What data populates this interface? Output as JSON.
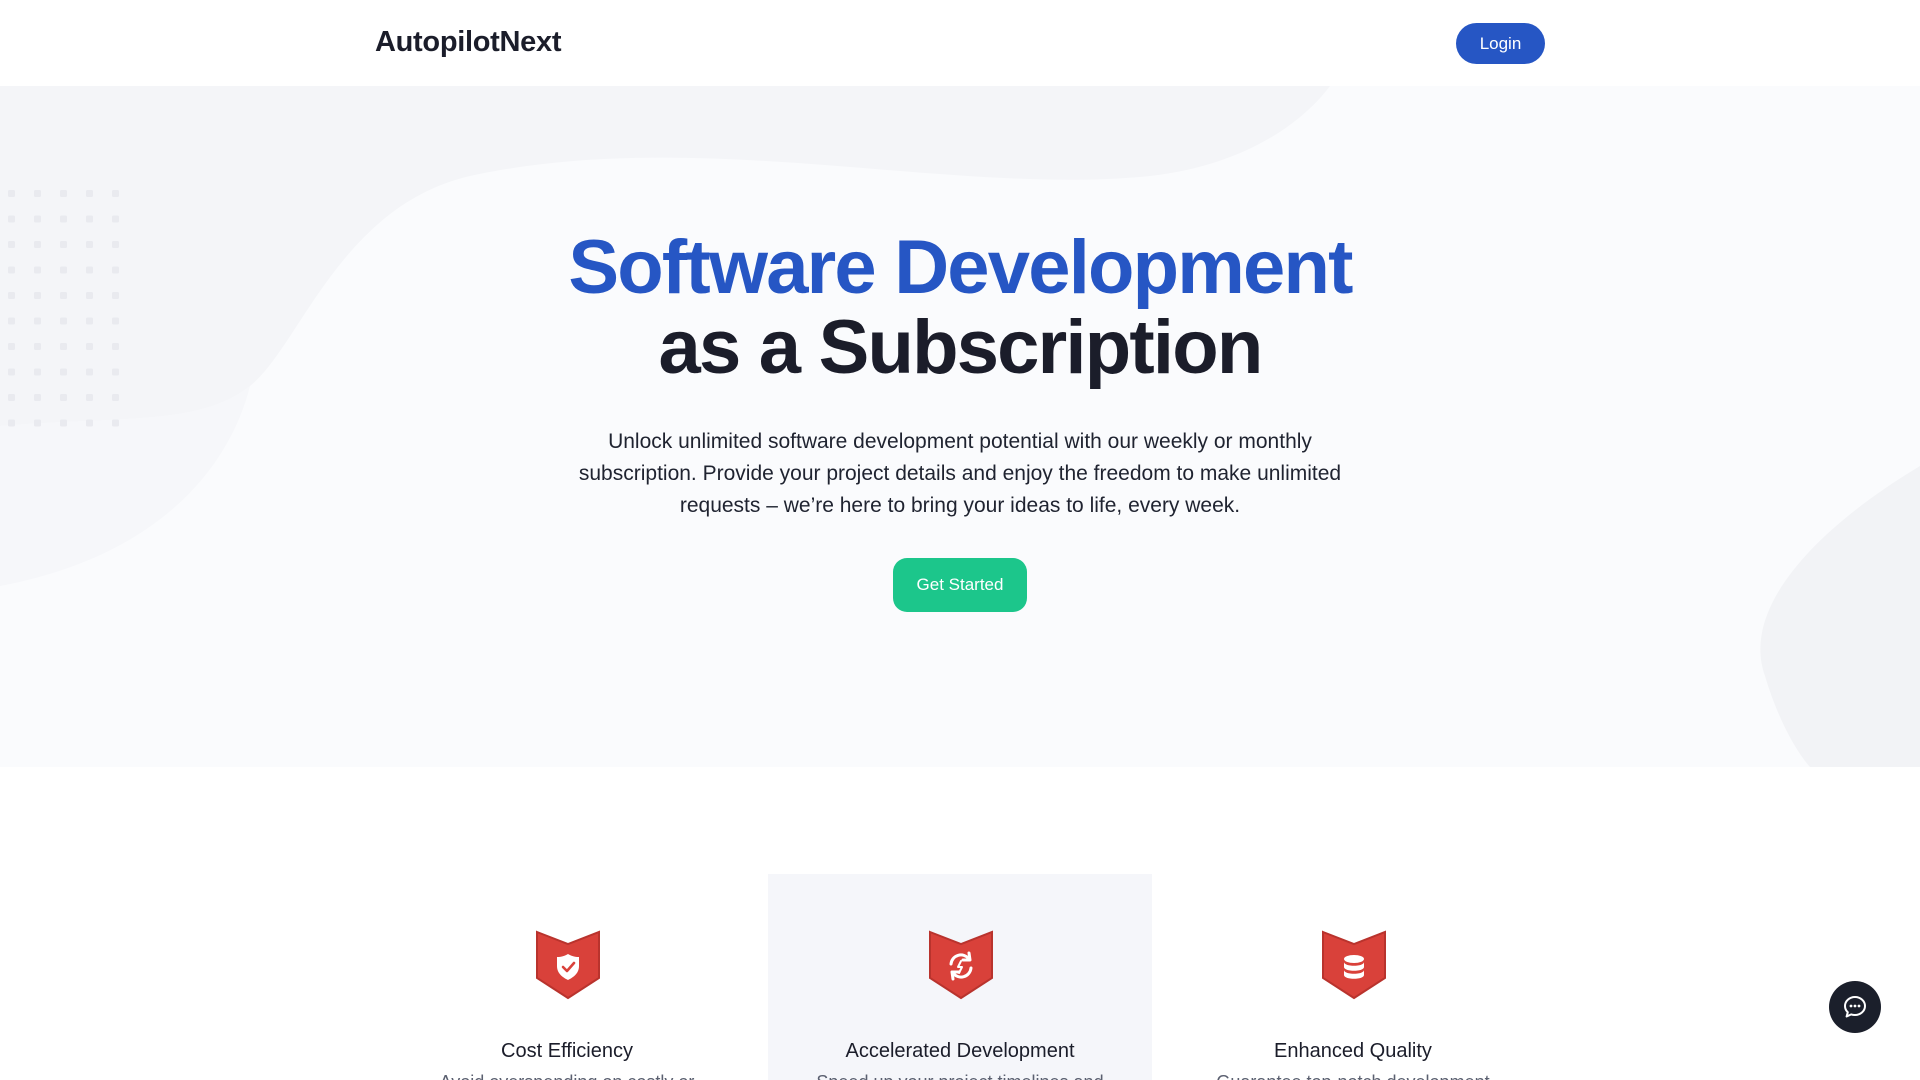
{
  "header": {
    "brand": "AutopilotNext",
    "login_label": "Login"
  },
  "hero": {
    "title_line1": "Software Development",
    "title_line2": "as a Subscription",
    "description": "Unlock unlimited software development potential with our weekly or monthly subscription. Provide your project details and enjoy the freedom to make unlimited requests – we’re here to bring your ideas to life, every week.",
    "cta_label": "Get Started"
  },
  "features": [
    {
      "title": "Cost Efficiency",
      "desc": "Avoid overspending on costly or",
      "icon": "shield-check-icon"
    },
    {
      "title": "Accelerated Development",
      "desc": "Speed up your project timelines and",
      "icon": "refresh-icon"
    },
    {
      "title": "Enhanced Quality",
      "desc": "Guarantee top-notch development",
      "icon": "database-icon"
    }
  ],
  "colors": {
    "brand_blue": "#2656c4",
    "cta_green": "#1cc68b",
    "icon_red": "#d9413a",
    "dark": "#1b1d2a"
  },
  "chat": {
    "icon": "chat-bubble-icon"
  }
}
